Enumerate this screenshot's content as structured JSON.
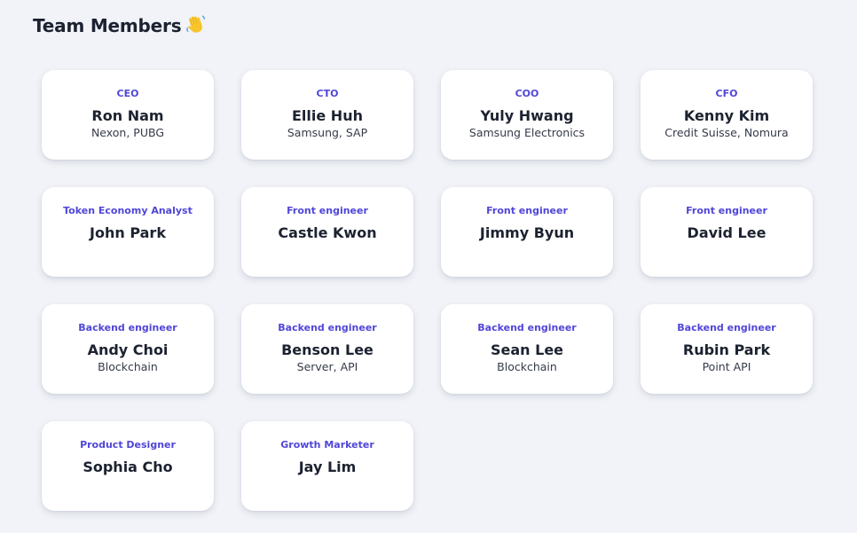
{
  "header": {
    "title": "Team Members",
    "icon": "waving-hand-icon"
  },
  "colors": {
    "accent": "#5046d8",
    "background": "#f1f3f8",
    "card": "#ffffff",
    "text": "#1c2230"
  },
  "members": [
    {
      "role": "CEO",
      "name": "Ron Nam",
      "company": "Nexon, PUBG"
    },
    {
      "role": "CTO",
      "name": "Ellie Huh",
      "company": "Samsung, SAP"
    },
    {
      "role": "COO",
      "name": "Yuly Hwang",
      "company": "Samsung Electronics"
    },
    {
      "role": "CFO",
      "name": "Kenny Kim",
      "company": "Credit Suisse, Nomura"
    },
    {
      "role": "Token Economy Analyst",
      "name": "John Park",
      "company": ""
    },
    {
      "role": "Front engineer",
      "name": "Castle Kwon",
      "company": ""
    },
    {
      "role": "Front engineer",
      "name": "Jimmy Byun",
      "company": ""
    },
    {
      "role": "Front engineer",
      "name": "David Lee",
      "company": ""
    },
    {
      "role": "Backend engineer",
      "name": "Andy Choi",
      "company": "Blockchain"
    },
    {
      "role": "Backend engineer",
      "name": "Benson Lee",
      "company": "Server, API"
    },
    {
      "role": "Backend engineer",
      "name": "Sean Lee",
      "company": "Blockchain"
    },
    {
      "role": "Backend engineer",
      "name": "Rubin Park",
      "company": "Point API"
    },
    {
      "role": "Product Designer",
      "name": "Sophia Cho",
      "company": ""
    },
    {
      "role": "Growth Marketer",
      "name": "Jay Lim",
      "company": ""
    }
  ]
}
